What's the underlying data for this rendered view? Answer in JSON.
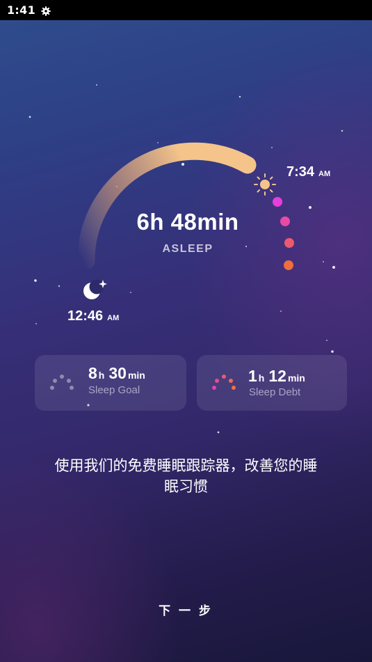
{
  "status_bar": {
    "time": "1:41",
    "settings_icon": "gear-icon"
  },
  "sleep_summary": {
    "duration": "6h 48min",
    "state_label": "ASLEEP",
    "wake_time": "7:34",
    "wake_ampm": "AM",
    "bed_time": "12:46",
    "bed_ampm": "AM",
    "wake_icon": "sun-icon",
    "bed_icon": "moon-icon",
    "arc_colors": [
      "#f4c48a",
      "#e9a978"
    ],
    "dot_colors": [
      "#e63fdc",
      "#ea4aa4",
      "#ec5a6e",
      "#ef6e3c"
    ]
  },
  "cards": {
    "goal": {
      "hours": "8",
      "hours_unit": "h",
      "minutes": "30",
      "minutes_unit": "min",
      "label": "Sleep Goal",
      "icon": "dotted-arc-icon"
    },
    "debt": {
      "hours": "1",
      "hours_unit": "h",
      "minutes": "12",
      "minutes_unit": "min",
      "label": "Sleep Debt",
      "icon": "dotted-arc-icon"
    }
  },
  "promo_text_line1": "使用我们的免费睡眠跟踪器，改善您的睡",
  "promo_text_line2": "眠习惯",
  "next_button_label": "下 一 步"
}
